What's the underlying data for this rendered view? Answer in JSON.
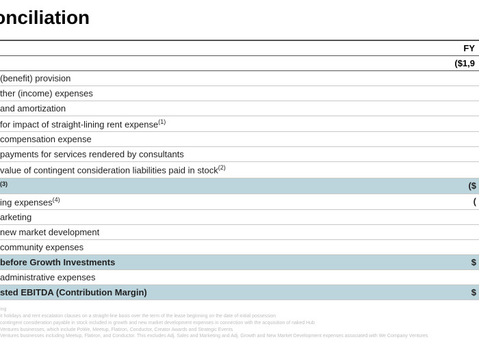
{
  "title": "econciliation",
  "header": {
    "col": "FY",
    "sub": "($1,9"
  },
  "rows": [
    {
      "label": "(benefit) provision",
      "shade": false
    },
    {
      "label": "ther (income) expenses",
      "shade": false
    },
    {
      "label": "and amortization",
      "shade": false
    },
    {
      "label": "for impact of straight-lining rent expense",
      "sup": "(1)",
      "shade": false
    },
    {
      "label": "compensation expense",
      "shade": false
    },
    {
      "label": "payments for services rendered by consultants",
      "shade": false
    },
    {
      "label": "value of contingent consideration liabilities paid in stock",
      "sup": "(2)",
      "shade": false
    },
    {
      "label": "",
      "sup": "(3)",
      "shade": true,
      "val": "($"
    },
    {
      "label": "ing expenses",
      "sup": "(4)",
      "shade": false,
      "val": "("
    },
    {
      "label": "arketing",
      "shade": false
    },
    {
      "label": "new market development",
      "shade": false
    },
    {
      "label": "community expenses",
      "shade": false
    },
    {
      "label": "before Growth Investments",
      "shade": true,
      "val": "$"
    },
    {
      "label": "administrative expenses",
      "shade": false
    },
    {
      "label": "sted EBITDA (Contribution Margin)",
      "shade": true,
      "val": "$"
    }
  ],
  "footnotes": [
    "ing",
    "it holidays and rent escalation clauses on a straight-line basis over the term of the lease beginning on the date of initial possession",
    "contingent consideration payable in stock included in growth and new market development expenses in connection with the acquisition of naked Hub",
    "Ventures businesses, which include PoWe, Meetup, Flatiron, Conductor, Creator Awards and Strategic Events",
    "Ventures businesses including Meetup, Flatiron, and Conductor. This excludes Adj. Sales and Marketing and Adj. Growth and New Market Development expenses associated with We Company Ventures"
  ]
}
